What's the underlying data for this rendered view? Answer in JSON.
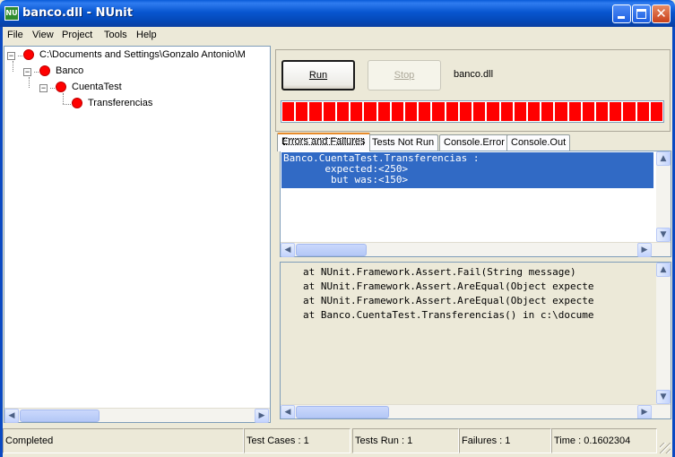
{
  "window": {
    "title": "banco.dll - NUnit",
    "icon_text": "NU"
  },
  "menu": [
    "File",
    "View",
    "Project",
    "Tools",
    "Help"
  ],
  "tree": {
    "nodes": [
      {
        "label": "C:\\Documents and Settings\\Gonzalo Antonio\\M",
        "status": "failed",
        "expander": "−"
      },
      {
        "label": "Banco",
        "status": "failed",
        "expander": "−"
      },
      {
        "label": "CuentaTest",
        "status": "failed",
        "expander": "−"
      },
      {
        "label": "Transferencias",
        "status": "failed"
      }
    ]
  },
  "run_panel": {
    "run_label": "Run",
    "stop_label": "Stop",
    "assembly": "banco.dll",
    "progress_color": "#ff0000",
    "progress_segments": 28
  },
  "tabs": [
    {
      "label": "Errors and Failures",
      "active": true
    },
    {
      "label": "Tests Not Run",
      "active": false
    },
    {
      "label": "Console.Error",
      "active": false
    },
    {
      "label": "Console.Out",
      "active": false
    }
  ],
  "errors": {
    "selected_text": "Banco.CuentaTest.Transferencias :\n       expected:<250>\n        but was:<150>"
  },
  "stack_trace": [
    "at NUnit.Framework.Assert.Fail(String message)",
    "at NUnit.Framework.Assert.AreEqual(Object expecte",
    "at NUnit.Framework.Assert.AreEqual(Object expecte",
    "at Banco.CuentaTest.Transferencias() in c:\\docume"
  ],
  "status": {
    "state": "Completed",
    "test_cases": "Test Cases : 1",
    "tests_run": "Tests Run : 1",
    "failures": "Failures : 1",
    "time": "Time : 0.1602304"
  },
  "colors": {
    "failed": "#ff0000",
    "selection": "#316ac5",
    "titlebar": "#0a5bd8"
  }
}
